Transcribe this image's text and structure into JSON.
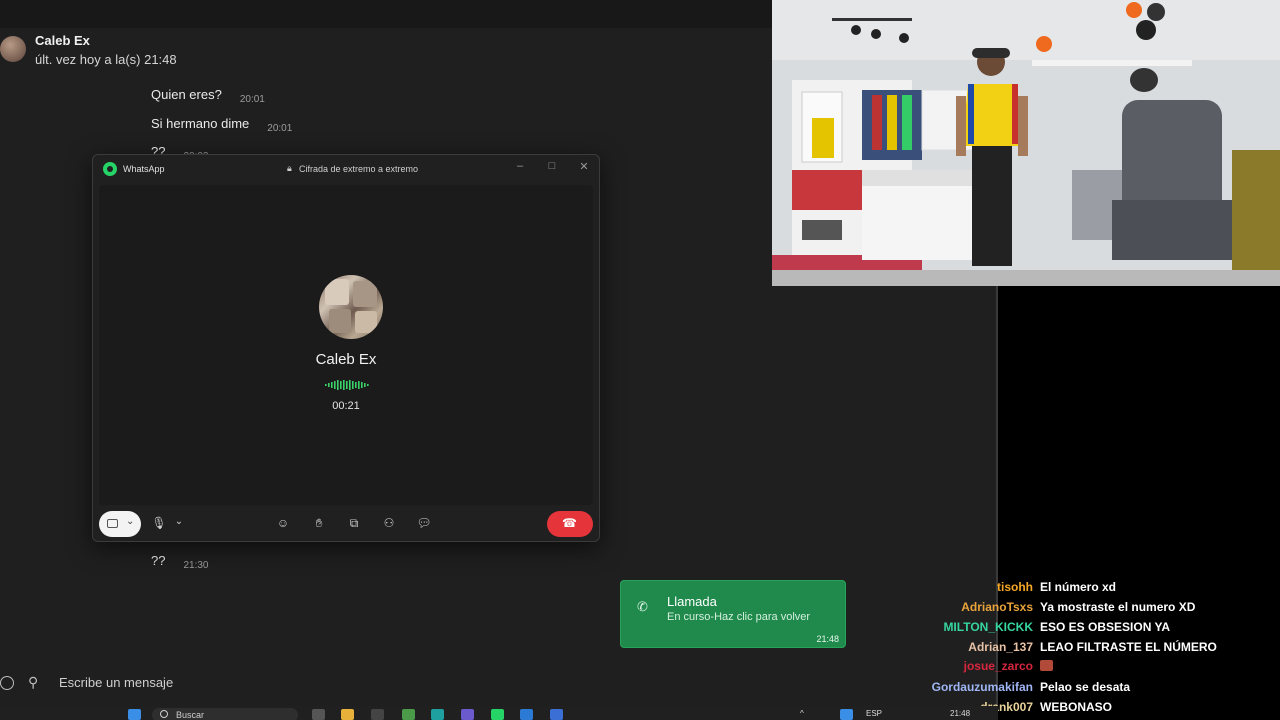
{
  "chat": {
    "contact_name": "Caleb Ex",
    "last_seen": "últ. vez hoy a la(s) 21:48",
    "messages": [
      {
        "text": "Quien eres?",
        "time": "20:01"
      },
      {
        "text": "Si hermano dime",
        "time": "20:01"
      },
      {
        "text": "??",
        "time": "20:02"
      },
      {
        "text": "??",
        "time": "21:30"
      }
    ],
    "composer_placeholder": "Escribe un mensaje"
  },
  "call_window": {
    "app_title": "WhatsApp",
    "encryption_label": "Cifrada de extremo a extremo",
    "callee_name": "Caleb Ex",
    "duration": "00:21",
    "controls": [
      "camera",
      "microphone",
      "emoji-reaction",
      "raise-hand",
      "share-screen",
      "add-person",
      "chat"
    ]
  },
  "toast": {
    "title": "Llamada",
    "subtitle": "En curso-Haz clic para volver",
    "time": "21:48"
  },
  "live_chat": [
    {
      "user": "tisohh",
      "text": "El número xd",
      "color": "#f5a623"
    },
    {
      "user": "AdrianoTsxs",
      "text": "Ya mostraste el numero XD",
      "color": "#e8a33b"
    },
    {
      "user": "MILTON_KICKK",
      "text": "ESO ES OBSESION YA",
      "color": "#36d6a0"
    },
    {
      "user": "Adrian_137",
      "text": "LEAO FILTRASTE EL NÚMERO",
      "color": "#e8c2a6"
    },
    {
      "user": "josue_zarco",
      "text": "",
      "color": "#d7263d"
    },
    {
      "user": "Gordauzumakifan",
      "text": "Pelao se desata",
      "color": "#9fb6f5"
    },
    {
      "user": "drank007",
      "text": "WEBONASO",
      "color": "#e8d29a"
    }
  ],
  "taskbar": {
    "search_placeholder": "Buscar",
    "language": "ESP",
    "clock": "21:48"
  }
}
